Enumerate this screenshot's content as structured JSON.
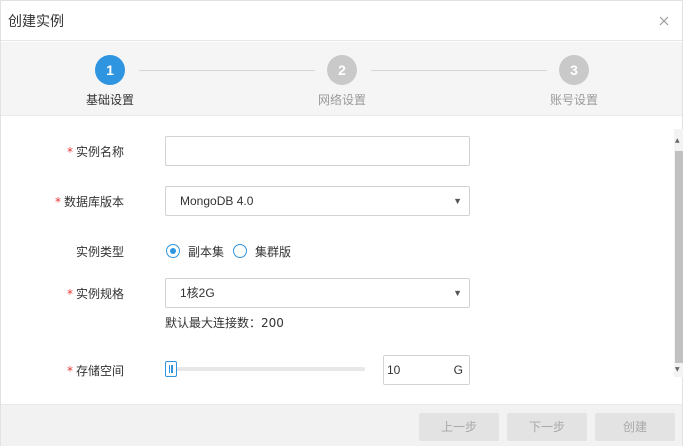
{
  "dialog": {
    "title": "创建实例",
    "close_icon": "close-icon"
  },
  "steps": [
    {
      "number": "1",
      "label": "基础设置",
      "state": "active"
    },
    {
      "number": "2",
      "label": "网络设置",
      "state": "inactive"
    },
    {
      "number": "3",
      "label": "账号设置",
      "state": "inactive"
    }
  ],
  "form": {
    "required_mark": "*",
    "instance_name": {
      "label": "实例名称",
      "value": "",
      "placeholder": ""
    },
    "db_version": {
      "label": "数据库版本",
      "selected": "MongoDB 4.0"
    },
    "instance_type": {
      "label": "实例类型",
      "options": [
        {
          "label": "副本集",
          "checked": true
        },
        {
          "label": "集群版",
          "checked": false
        }
      ]
    },
    "instance_spec": {
      "label": "实例规格",
      "selected": "1核2G",
      "hint": "默认最大连接数：200"
    },
    "storage": {
      "label": "存储空间",
      "value": "10",
      "unit": "G"
    }
  },
  "footer": {
    "prev_label": "上一步",
    "next_label": "下一步",
    "create_label": "创建"
  },
  "colors": {
    "accent": "#2f95e0",
    "required": "#e53935",
    "step_inactive": "#c9c9c9"
  }
}
